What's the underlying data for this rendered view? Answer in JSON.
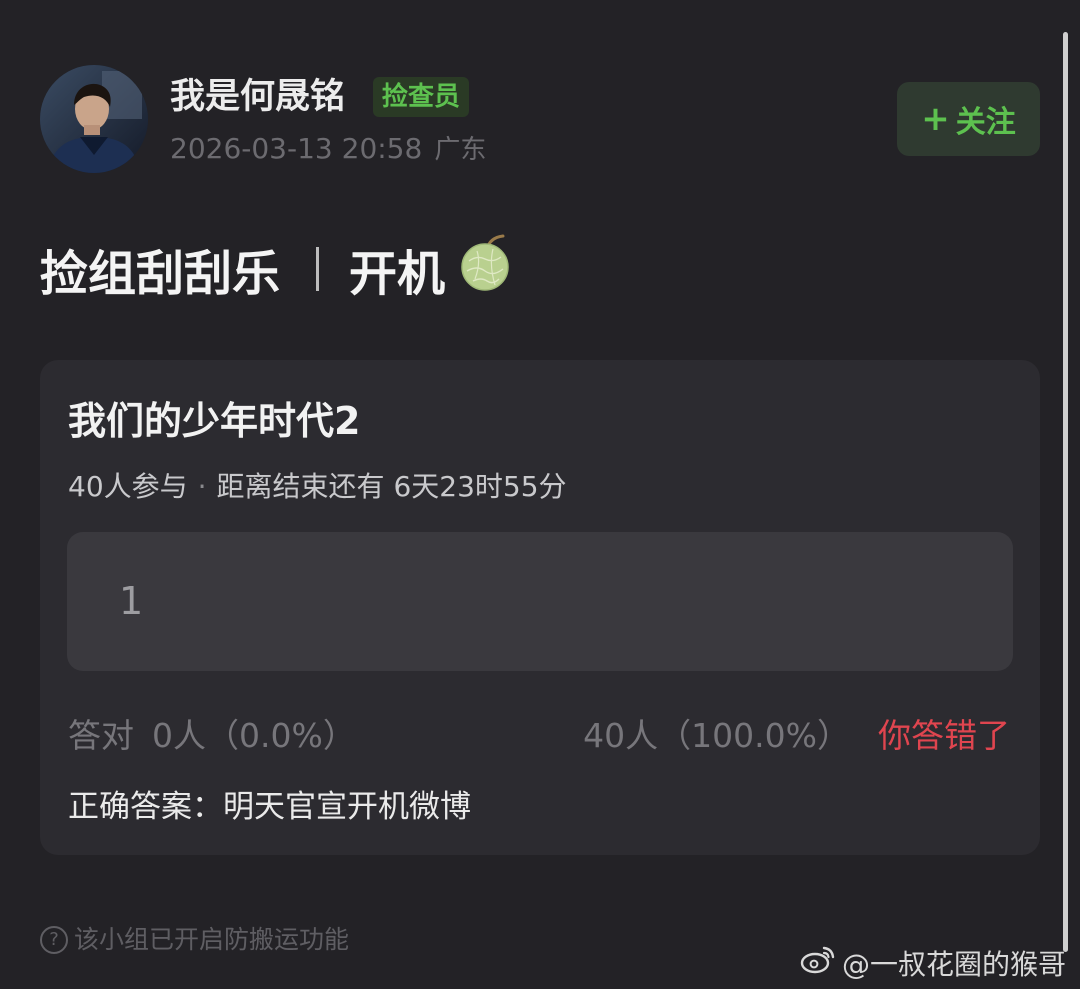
{
  "author": {
    "name": "我是何晟铭",
    "role_badge": "捡查员",
    "timestamp": "2026-03-13 20:58",
    "location": "广东",
    "follow_label": "关注",
    "follow_icon": "+"
  },
  "post": {
    "title_left": "捡组刮刮乐",
    "title_right": "开机",
    "emoji": "melon"
  },
  "quiz": {
    "title": "我们的少年时代2",
    "participants": "40人参与",
    "countdown_label": "距离结束还有",
    "countdown_value": "6天23时55分",
    "option_text": "1",
    "correct_label": "答对",
    "correct_stat": "0人（0.0%）",
    "wrong_stat": "40人（100.0%）",
    "result_text": "你答错了",
    "answer_line": "正确答案：明天官宣开机微博"
  },
  "footer": {
    "note": "该小组已开启防搬运功能",
    "watermark": "@一叔花圈的猴哥"
  },
  "colors": {
    "background": "#232226",
    "card": "#2c2b30",
    "accent_green": "#5dc14f",
    "error_red": "#e0454f"
  }
}
